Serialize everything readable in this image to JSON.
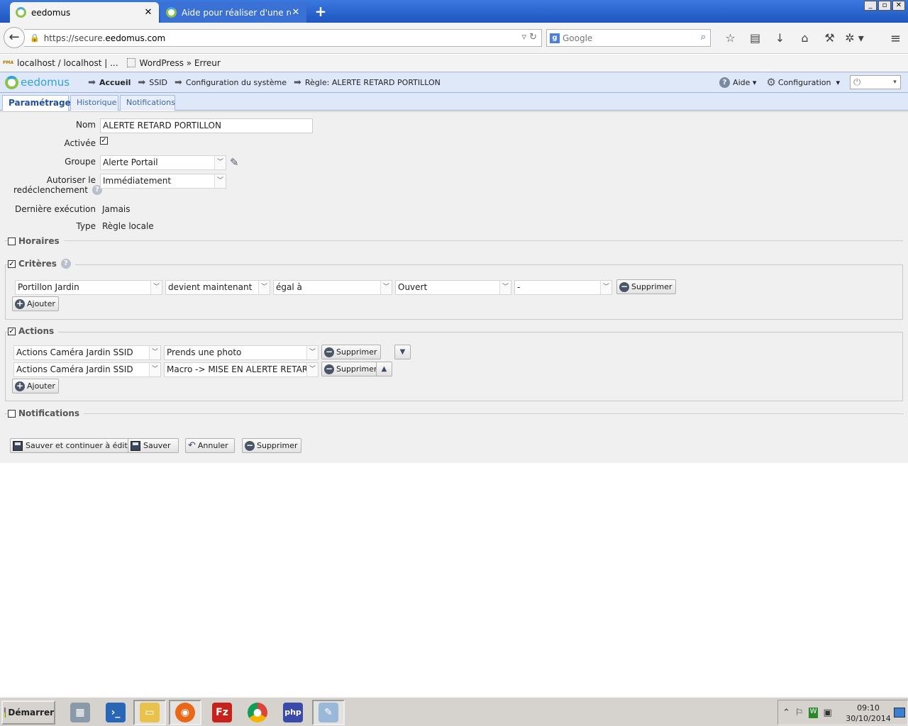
{
  "browser": {
    "tabs": [
      {
        "title": "eedomus",
        "close": "✕"
      },
      {
        "title": "Aide pour réaliser d'une règle ...",
        "close": "✕"
      }
    ],
    "new_tab": "+",
    "url_scheme": "https://secure.",
    "url_host": "eedomus.com",
    "search_placeholder": "Google",
    "bookmarks": [
      "localhost / localhost | ...",
      "WordPress » Erreur"
    ]
  },
  "app": {
    "logo_text": "eedomus",
    "breadcrumb": [
      "Accueil",
      "SSID",
      "Configuration du système",
      "Règle: ALERTE RETARD PORTILLON"
    ],
    "help_label": "Aide",
    "config_label": "Configuration",
    "tabs": [
      "Paramétrage",
      "Historique",
      "Notifications"
    ]
  },
  "form": {
    "nom_label": "Nom",
    "nom_value": "ALERTE RETARD PORTILLON",
    "activee_label": "Activée",
    "groupe_label": "Groupe",
    "groupe_value": "Alerte Portail",
    "redecl_label_1": "Autoriser le",
    "redecl_label_2": "redéclenchement",
    "redecl_value": "Immédiatement",
    "derniere_label": "Dernière exécution",
    "derniere_value": "Jamais",
    "type_label": "Type",
    "type_value": "Règle locale"
  },
  "sections": {
    "horaires": "Horaires",
    "criteres": "Critères",
    "actions": "Actions",
    "notifications": "Notifications"
  },
  "criteria": [
    {
      "device": "Portillon Jardin",
      "condition": "devient maintenant",
      "operator": "égal à",
      "value": "Ouvert",
      "extra": "-",
      "delete": "Supprimer"
    }
  ],
  "actions": [
    {
      "device": "Actions Caméra Jardin SSID",
      "action": "Prends une photo",
      "delete": "Supprimer"
    },
    {
      "device": "Actions Caméra Jardin SSID",
      "action": "Macro -> MISE EN ALERTE RETARD",
      "delete": "Supprimer"
    }
  ],
  "add_label": "Ajouter",
  "buttons": {
    "save_continue": "Sauver et continuer à éditer",
    "save": "Sauver",
    "cancel": "Annuler",
    "delete": "Supprimer"
  },
  "taskbar": {
    "start": "Démarrer",
    "time": "09:10",
    "date": "30/10/2014"
  },
  "colors": {
    "titlebar": "#2a64d0",
    "app_header": "#dfe8f8",
    "tab_link": "#3b66b0",
    "logo": "#2da3d9"
  }
}
